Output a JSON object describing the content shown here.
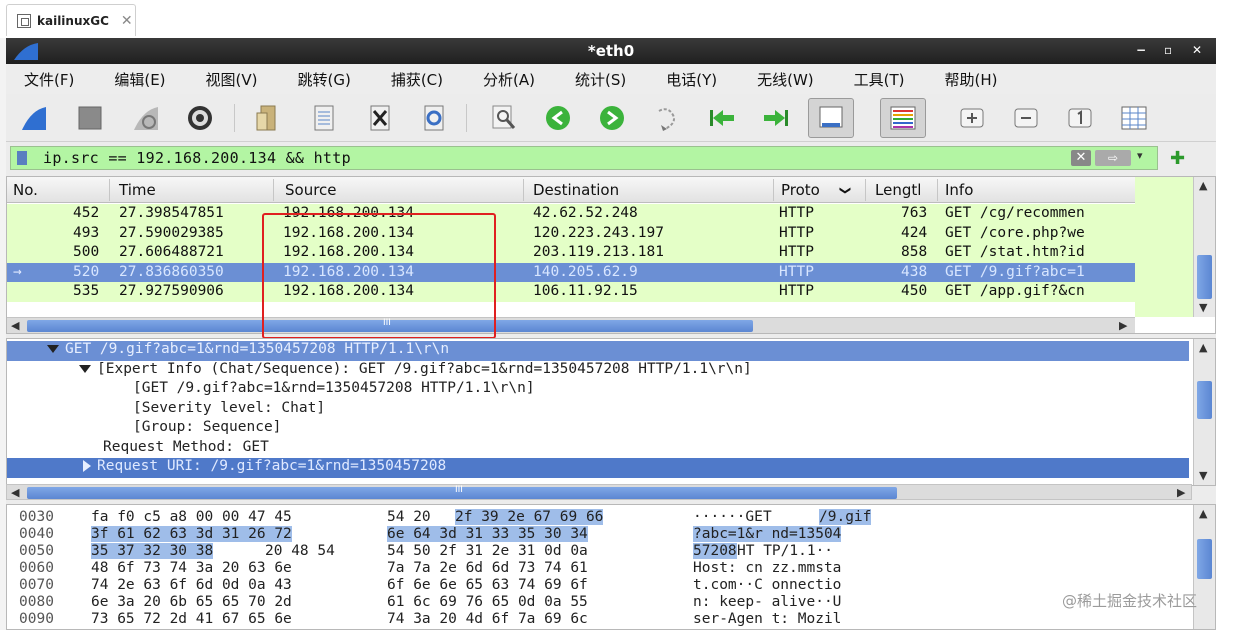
{
  "browser_tab": {
    "title": "kailinuxGC",
    "close": "✕"
  },
  "window": {
    "title": "*eth0",
    "controls": [
      "−",
      "▫",
      "✕"
    ]
  },
  "menu": [
    "文件(F)",
    "编辑(E)",
    "视图(V)",
    "跳转(G)",
    "捕获(C)",
    "分析(A)",
    "统计(S)",
    "电话(Y)",
    "无线(W)",
    "工具(T)",
    "帮助(H)"
  ],
  "toolbar": {
    "icons": [
      "shark-start-icon",
      "stop-icon",
      "restart-icon",
      "options-gear-icon",
      "open-file-icon",
      "save-file-icon",
      "close-file-icon",
      "reload-icon",
      "find-icon",
      "go-back-icon",
      "go-forward-icon",
      "go-to-packet-icon",
      "first-packet-icon",
      "last-packet-icon",
      "autoscroll-icon",
      "colorize-icon",
      "zoom-in-icon",
      "zoom-out-icon",
      "normal-size-icon",
      "resize-columns-icon"
    ]
  },
  "filter": {
    "value": "ip.src == 192.168.200.134 && http",
    "clear": "✕",
    "apply": "⇨",
    "dropdown": "▾",
    "add": "✚"
  },
  "packet_list": {
    "columns": [
      "No.",
      "Time",
      "Source",
      "Destination",
      "Proto",
      "Lengtl",
      "Info"
    ],
    "sort_indicator": "❯",
    "rows": [
      {
        "no": "452",
        "time": "27.398547851",
        "source": "192.168.200.134",
        "destination": "42.62.52.248",
        "proto": "HTTP",
        "length": "763",
        "info": "GET /cg/recommen"
      },
      {
        "no": "493",
        "time": "27.590029385",
        "source": "192.168.200.134",
        "destination": "120.223.243.197",
        "proto": "HTTP",
        "length": "424",
        "info": "GET /core.php?we"
      },
      {
        "no": "500",
        "time": "27.606488721",
        "source": "192.168.200.134",
        "destination": "203.119.213.181",
        "proto": "HTTP",
        "length": "858",
        "info": "GET /stat.htm?id"
      },
      {
        "no": "520",
        "time": "27.836860350",
        "source": "192.168.200.134",
        "destination": "140.205.62.9",
        "proto": "HTTP",
        "length": "438",
        "info": "GET /9.gif?abc=1"
      },
      {
        "no": "535",
        "time": "27.927590906",
        "source": "192.168.200.134",
        "destination": "106.11.92.15",
        "proto": "HTTP",
        "length": "450",
        "info": "GET /app.gif?&cn"
      }
    ],
    "selected_marker": "→",
    "hscroll_grip": "III"
  },
  "details": {
    "lines": [
      "GET /9.gif?abc=1&rnd=1350457208 HTTP/1.1\\r\\n",
      "[Expert Info (Chat/Sequence): GET /9.gif?abc=1&rnd=1350457208 HTTP/1.1\\r\\n]",
      "[GET /9.gif?abc=1&rnd=1350457208 HTTP/1.1\\r\\n]",
      "[Severity level: Chat]",
      "[Group: Sequence]",
      "Request Method: GET",
      "Request URI: /9.gif?abc=1&rnd=1350457208"
    ],
    "hscroll_grip": "III"
  },
  "hex": {
    "rows": [
      {
        "offset": "0030",
        "bytes_a": "fa f0 c5 a8 00 00 47 45",
        "bytes_b": "54 20",
        "bytes_b_sel": "2f 39 2e 67 69 66",
        "ascii_a": "······GE",
        "ascii_b": "T ",
        "ascii_b_sel": "/9.gif"
      },
      {
        "offset": "0040",
        "bytes_sel_a": "3f 61 62 63 3d 31 26 72",
        "bytes_sel_b": "6e 64 3d 31 33 35 30 34",
        "ascii_sel": "?abc=1&r nd=13504"
      },
      {
        "offset": "0050",
        "bytes_sel_a": "35 37 32 30 38",
        "bytes_a": "20 48 54",
        "bytes_b": "54 50 2f 31 2e 31 0d 0a",
        "ascii_sel": "57208",
        "ascii_rest": " HT TP/1.1··"
      },
      {
        "offset": "0060",
        "bytes_a": "48 6f 73 74 3a 20 63 6e",
        "bytes_b": "7a 7a 2e 6d 6d 73 74 61",
        "ascii": "Host: cn zz.mmsta"
      },
      {
        "offset": "0070",
        "bytes_a": "74 2e 63 6f 6d 0d 0a 43",
        "bytes_b": "6f 6e 6e 65 63 74 69 6f",
        "ascii": "t.com··C onnectio"
      },
      {
        "offset": "0080",
        "bytes_a": "6e 3a 20 6b 65 65 70 2d",
        "bytes_b": "61 6c 69 76 65 0d 0a 55",
        "ascii": "n: keep- alive··U"
      },
      {
        "offset": "0090",
        "bytes_a": "73 65 72 2d 41 67 65 6e",
        "bytes_b": "74 3a 20 4d 6f 7a 69 6c",
        "ascii": "ser-Agen t: Mozil"
      }
    ]
  },
  "watermark": "@稀土掘金技术社区"
}
